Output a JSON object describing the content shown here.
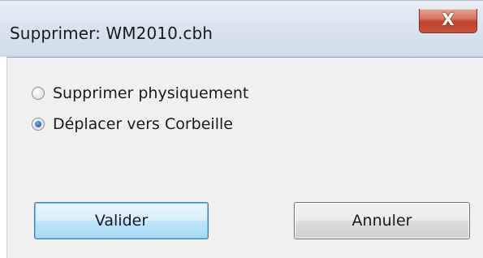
{
  "window": {
    "title": "Supprimer: WM2010.cbh",
    "close_glyph": "X"
  },
  "options": [
    {
      "label": "Supprimer physiquement",
      "checked": false
    },
    {
      "label": "Déplacer vers Corbeille",
      "checked": true
    }
  ],
  "buttons": {
    "validate_label": "Valider",
    "cancel_label": "Annuler"
  },
  "colors": {
    "client_bg": "#f0f0f0",
    "close_red": "#c0432a",
    "default_button_border": "#3c7fb1"
  }
}
